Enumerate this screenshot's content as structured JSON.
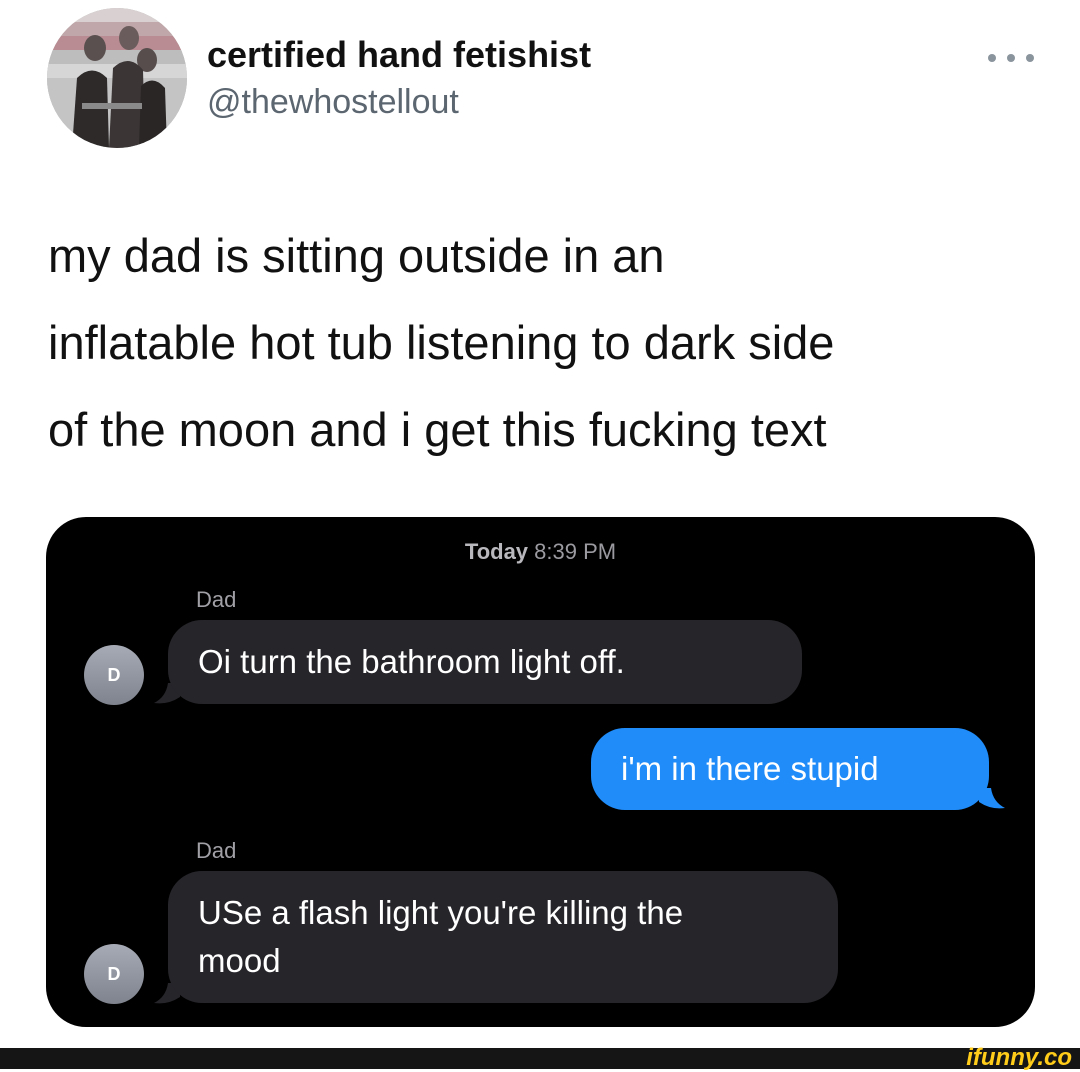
{
  "tweet": {
    "display_name": "certified hand fetishist",
    "handle": "@thewhostellout",
    "more_icon": "more-horizontal-icon",
    "text_lines": [
      "my dad is sitting outside in an",
      "inflatable hot tub listening to dark side",
      "of the moon and i get this fucking text"
    ]
  },
  "conversation": {
    "timestamp_day": "Today",
    "timestamp_time": "8:39 PM",
    "messages": [
      {
        "sender": "Dad",
        "avatar_initial": "D",
        "direction": "incoming",
        "lines": [
          "Oi turn the bathroom light off."
        ]
      },
      {
        "direction": "outgoing",
        "lines": [
          "i'm in there stupid"
        ]
      },
      {
        "sender": "Dad",
        "avatar_initial": "D",
        "direction": "incoming",
        "lines": [
          "USe a flash light you're killing the",
          "mood"
        ]
      }
    ]
  },
  "watermark": {
    "text": "ifunny.co"
  },
  "colors": {
    "incoming_bubble": "#26252a",
    "outgoing_bubble": "#1f8cf9",
    "watermark": "#ffcc1a"
  }
}
